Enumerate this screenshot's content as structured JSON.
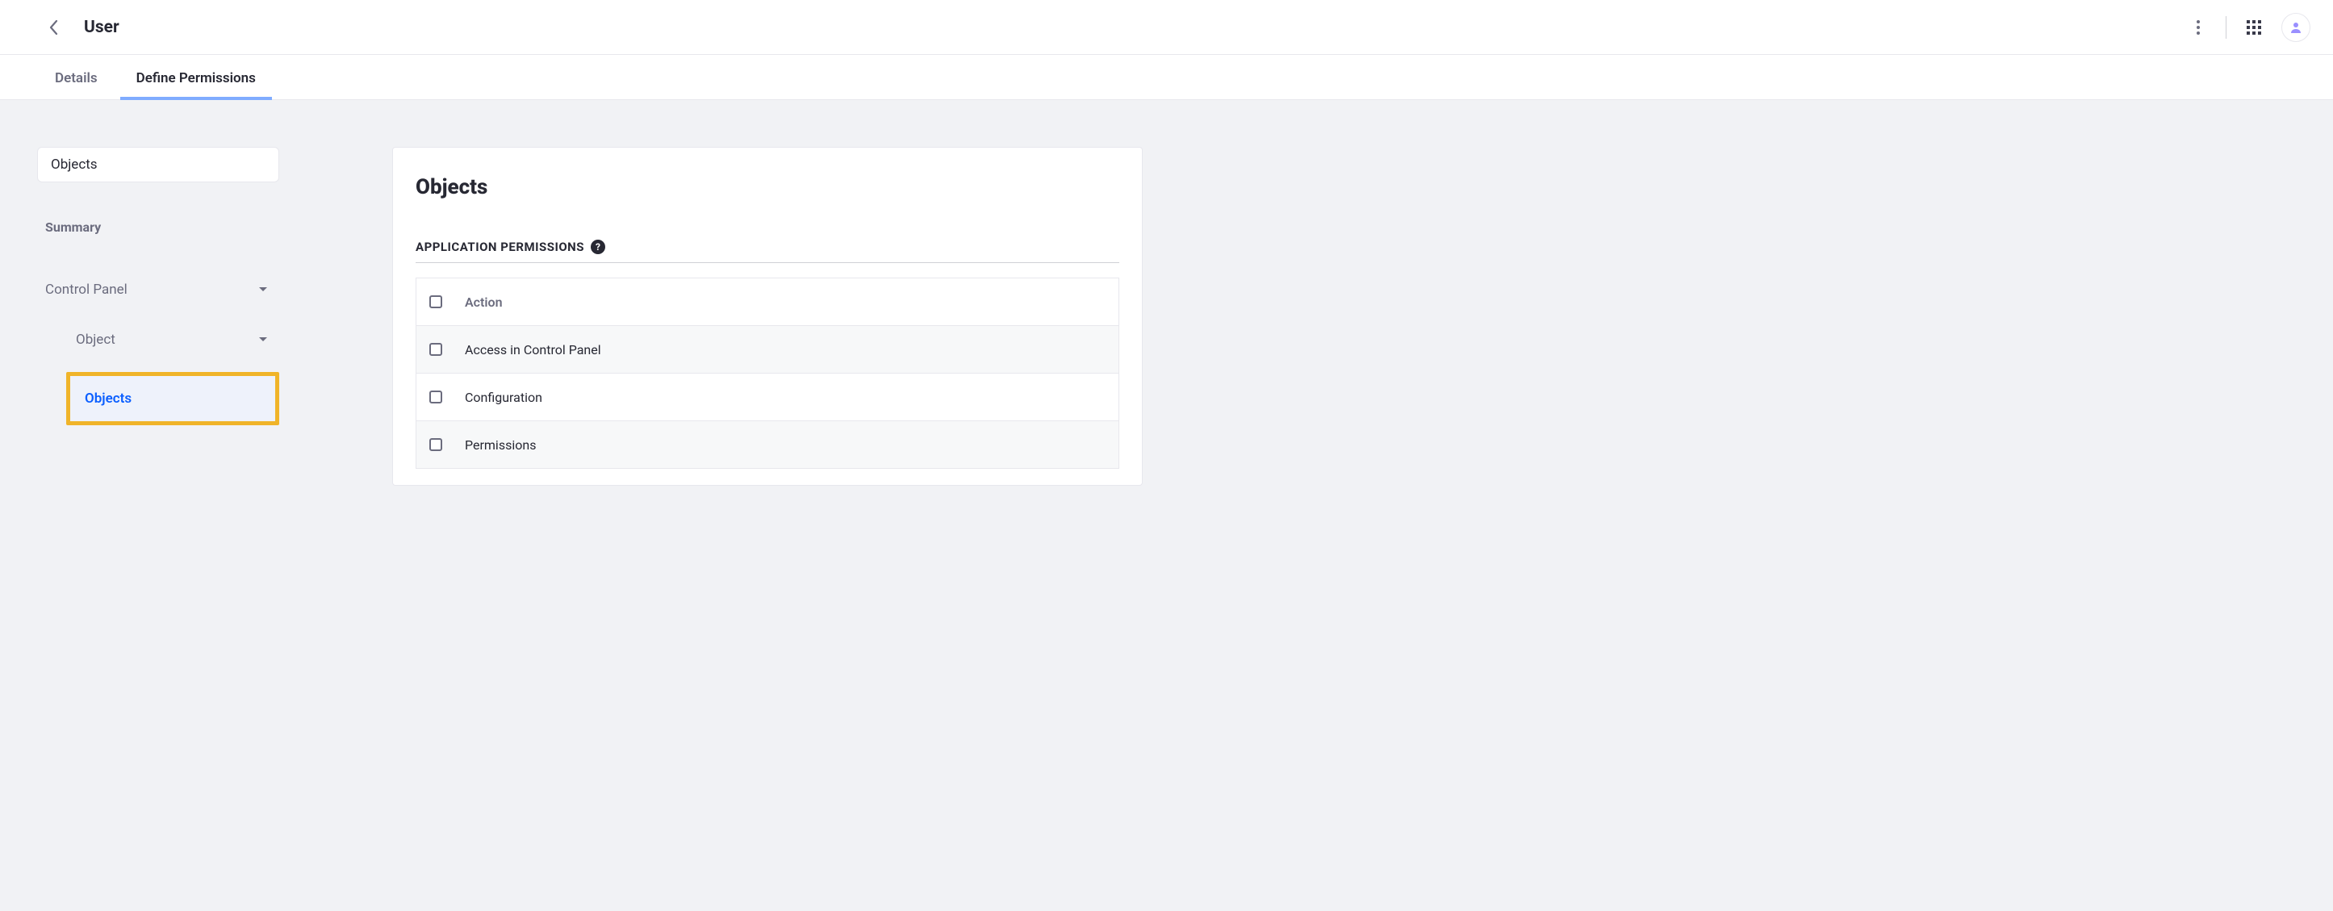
{
  "header": {
    "title": "User"
  },
  "tabs": [
    {
      "label": "Details",
      "active": false
    },
    {
      "label": "Define Permissions",
      "active": true
    }
  ],
  "sidebar": {
    "search_value": "Objects",
    "summary_label": "Summary",
    "tree": {
      "lvl1": "Control Panel",
      "lvl2": "Object",
      "lvl3": "Objects"
    }
  },
  "panel": {
    "title": "Objects",
    "section_label": "APPLICATION PERMISSIONS",
    "table": {
      "header": "Action",
      "rows": [
        "Access in Control Panel",
        "Configuration",
        "Permissions"
      ]
    }
  }
}
